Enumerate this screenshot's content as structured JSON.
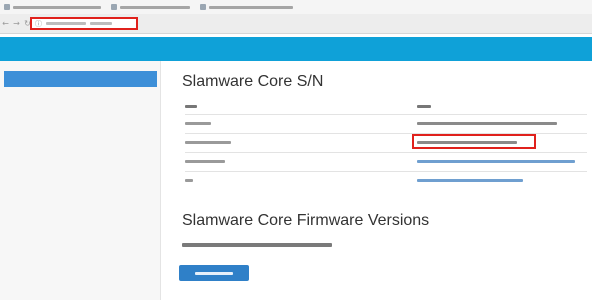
{
  "browser": {
    "url": "",
    "back_icon": "back-arrow-icon",
    "forward_icon": "forward-arrow-icon",
    "reload_icon": "reload-icon",
    "bookmarks": [
      {
        "label": ""
      },
      {
        "label": ""
      },
      {
        "label": ""
      }
    ]
  },
  "app": {
    "brand": "",
    "header_color": "#0fa1d8"
  },
  "sidebar": {
    "items": [
      {
        "label": "",
        "active": true
      },
      {
        "label": "",
        "active": false
      }
    ]
  },
  "main": {
    "title": "Slamware Core S/N",
    "table": {
      "headers": [
        "",
        ""
      ],
      "rows": [
        {
          "key": "",
          "value": ""
        },
        {
          "key": "",
          "value": ""
        },
        {
          "key": "",
          "value": ""
        },
        {
          "key": "",
          "value": ""
        }
      ]
    },
    "firmware_title": "Slamware Core Firmware Versions",
    "firmware_version": "",
    "button_label": ""
  },
  "colors": {
    "accent": "#0fa1d8",
    "sidebar_active": "#3d8fd8",
    "button": "#2f80c8",
    "annotation_red": "#e0211c"
  }
}
